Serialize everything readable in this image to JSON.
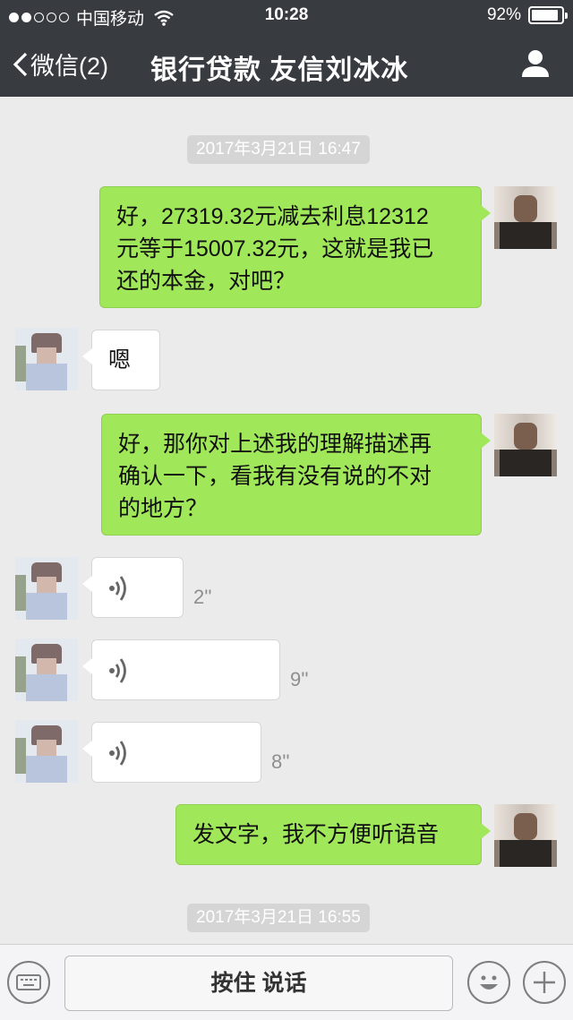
{
  "status_bar": {
    "carrier": "中国移动",
    "time": "10:28",
    "battery": "92%",
    "battery_level": 0.92
  },
  "nav": {
    "back_label": "微信(2)",
    "title": "银行贷款 友信刘冰冰"
  },
  "timestamps": [
    "2017年3月21日 16:47",
    "2017年3月21日 16:55"
  ],
  "messages": [
    {
      "from": "me",
      "type": "text",
      "lines": [
        "好，27319.32元减去利息12312",
        "元等于15007.32元，这就是我已",
        "还的本金，对吧？"
      ]
    },
    {
      "from": "other",
      "type": "text",
      "text": "嗯"
    },
    {
      "from": "me",
      "type": "text",
      "lines": [
        "好，那你对上述我的理解描述再",
        "确认一下，看我有没有说的不对",
        "的地方？"
      ]
    },
    {
      "from": "other",
      "type": "voice",
      "duration": "2''"
    },
    {
      "from": "other",
      "type": "voice",
      "duration": "9''"
    },
    {
      "from": "other",
      "type": "voice",
      "duration": "8''"
    },
    {
      "from": "me",
      "type": "text",
      "text": "发文字，我不方便听语音"
    }
  ],
  "input_bar": {
    "hold_to_talk": "按住 说话",
    "icons": [
      "keyboard-icon",
      "emoji-icon",
      "plus-icon"
    ]
  },
  "colors": {
    "nav_bg": "#383b40",
    "chat_bg": "#ebebeb",
    "my_bubble": "#a0e75a",
    "other_bubble": "#ffffff"
  }
}
